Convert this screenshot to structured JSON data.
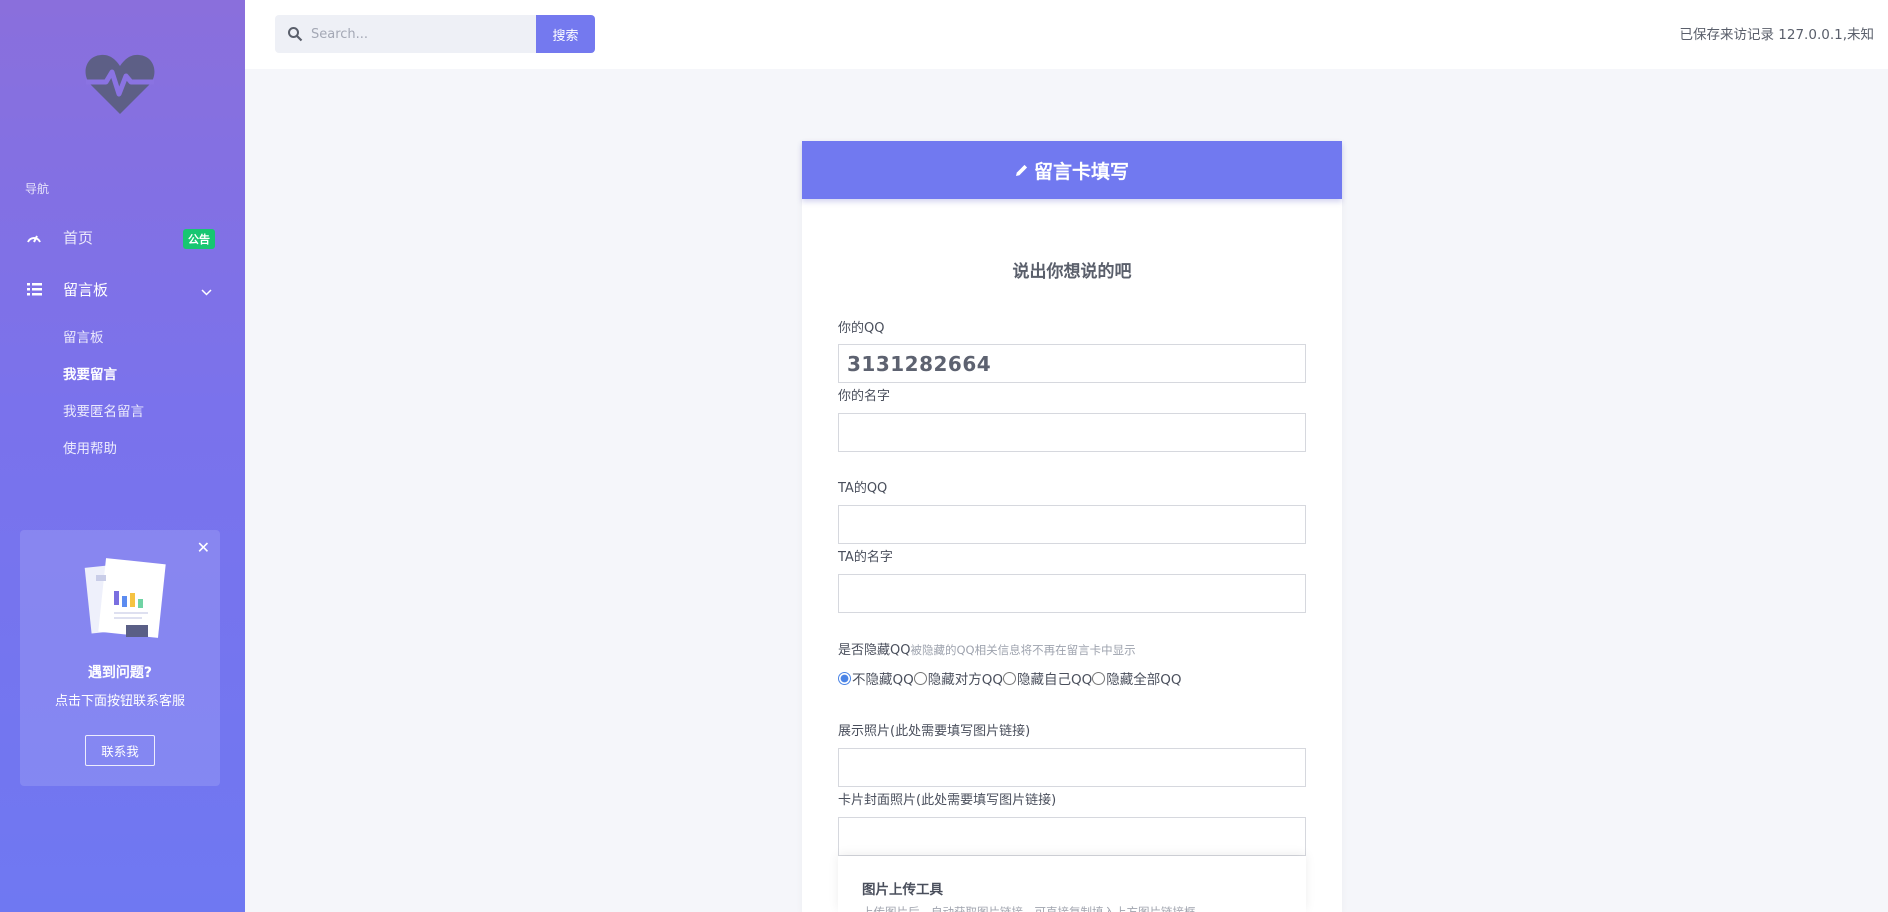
{
  "sidebar": {
    "logo_icon": "heart-pulse-icon",
    "nav_heading": "导航",
    "items": [
      {
        "label": "首页",
        "icon": "speedometer-icon",
        "badge": "公告"
      },
      {
        "label": "留言板",
        "icon": "list-icon"
      }
    ],
    "sub_items": [
      {
        "label": "留言板"
      },
      {
        "label": "我要留言"
      },
      {
        "label": "我要匿名留言"
      },
      {
        "label": "使用帮助"
      }
    ],
    "help": {
      "title": "遇到问题?",
      "text": "点击下面按钮联系客服",
      "button": "联系我"
    }
  },
  "topbar": {
    "search_placeholder": "Search...",
    "search_button": "搜索",
    "visit_info": "已保存来访记录 127.0.0.1,未知"
  },
  "card": {
    "header": "留言卡填写",
    "form_title": "说出你想说的吧",
    "fields": {
      "your_qq_label": "你的QQ",
      "your_qq_value": "3131282664",
      "your_name_label": "你的名字",
      "ta_qq_label": "TA的QQ",
      "ta_name_label": "TA的名字",
      "hide_label": "是否隐藏QQ",
      "hide_hint": "被隐藏的QQ相关信息将不再在留言卡中显示",
      "photo_label": "展示照片(此处需要填写图片链接)",
      "cover_label": "卡片封面照片(此处需要填写图片链接)"
    },
    "hide_options": [
      {
        "label": "不隐藏QQ",
        "checked": true
      },
      {
        "label": "隐藏对方QQ",
        "checked": false
      },
      {
        "label": "隐藏自己QQ",
        "checked": false
      },
      {
        "label": "隐藏全部QQ",
        "checked": false
      }
    ],
    "upload": {
      "title": "图片上传工具",
      "subtitle": "上传图片后，自动获取图片链接，可直接复制填入上方图片链接框"
    }
  },
  "colors": {
    "accent": "#7179f0",
    "sidebar_top": "#8a6fdc",
    "sidebar_bottom": "#6f78f2",
    "badge": "#17c671"
  }
}
